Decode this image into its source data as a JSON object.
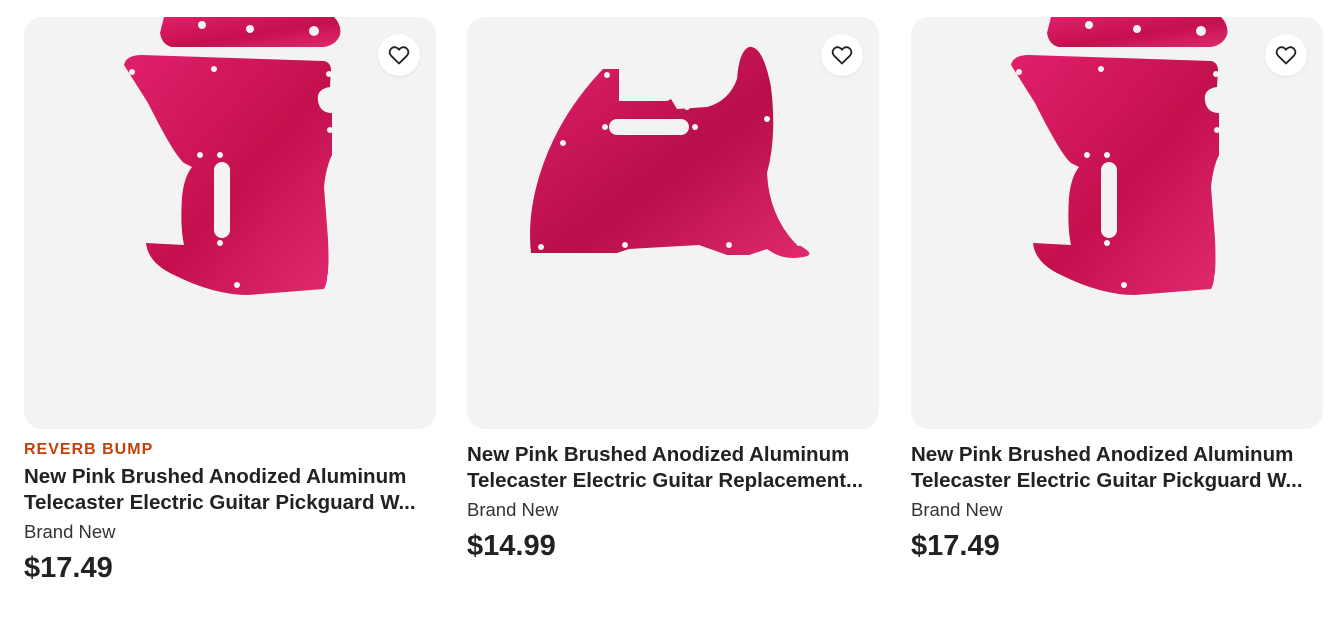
{
  "listings": [
    {
      "badge": "REVERB BUMP",
      "title": "New Pink Brushed Anodized Aluminum Telecaster Electric Guitar Pickguard W...",
      "condition": "Brand New",
      "price": "$17.49",
      "image_icon": "pickguard-photo",
      "favorite_icon": "heart-outline-icon"
    },
    {
      "badge": "",
      "title": "New Pink Brushed Anodized Aluminum Telecaster Electric Guitar Replacement...",
      "condition": "Brand New",
      "price": "$14.99",
      "image_icon": "pickguard-photo",
      "favorite_icon": "heart-outline-icon"
    },
    {
      "badge": "",
      "title": "New Pink Brushed Anodized Aluminum Telecaster Electric Guitar Pickguard W...",
      "condition": "Brand New",
      "price": "$17.49",
      "image_icon": "pickguard-photo",
      "favorite_icon": "heart-outline-icon"
    }
  ],
  "colors": {
    "badge": "#c2410c",
    "pickguard": "#d6155c",
    "image_background": "#f3f3f3"
  }
}
